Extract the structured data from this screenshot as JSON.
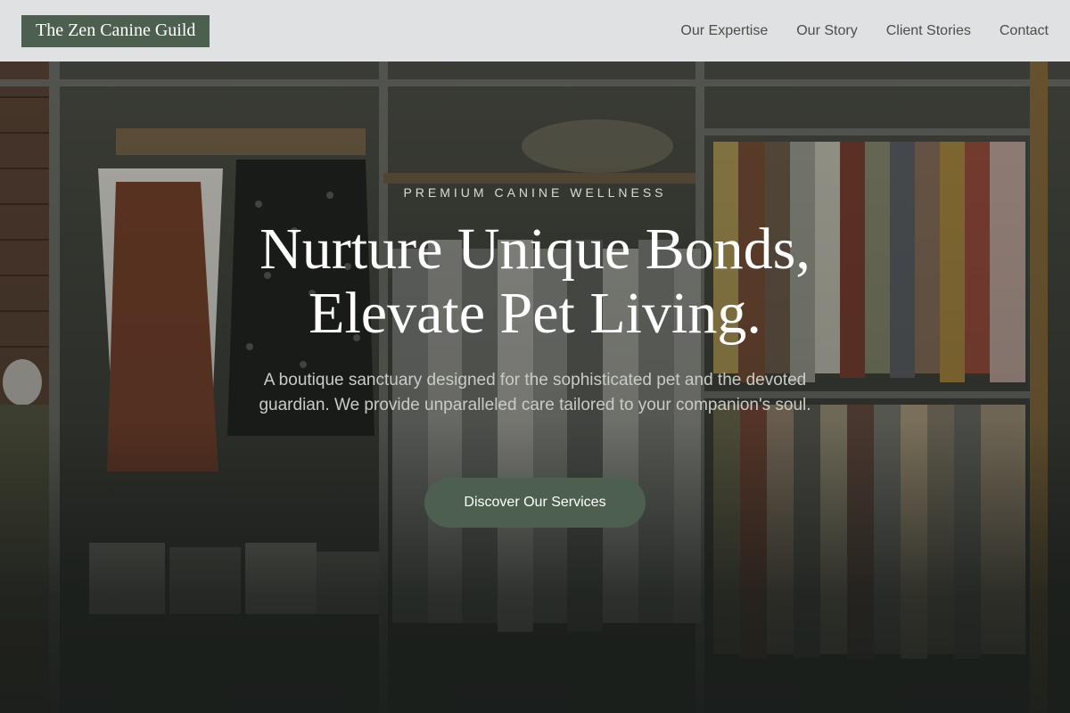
{
  "brand": {
    "name": "The Zen Canine Guild"
  },
  "nav": {
    "items": [
      {
        "label": "Our Expertise"
      },
      {
        "label": "Our Story"
      },
      {
        "label": "Client Stories"
      },
      {
        "label": "Contact"
      }
    ]
  },
  "hero": {
    "eyebrow": "PREMIUM CANINE WELLNESS",
    "headline_line1": "Nurture Unique Bonds,",
    "headline_line2": "Elevate Pet Living.",
    "subhead": "A boutique sanctuary designed for the sophisticated pet and the devoted guardian. We provide unparalleled care tailored to your companion's soul.",
    "cta_label": "Discover Our Services"
  },
  "colors": {
    "accent": "#4d5f4f",
    "header_bg": "#dfe1e2",
    "nav_text": "#4a4f4b"
  }
}
